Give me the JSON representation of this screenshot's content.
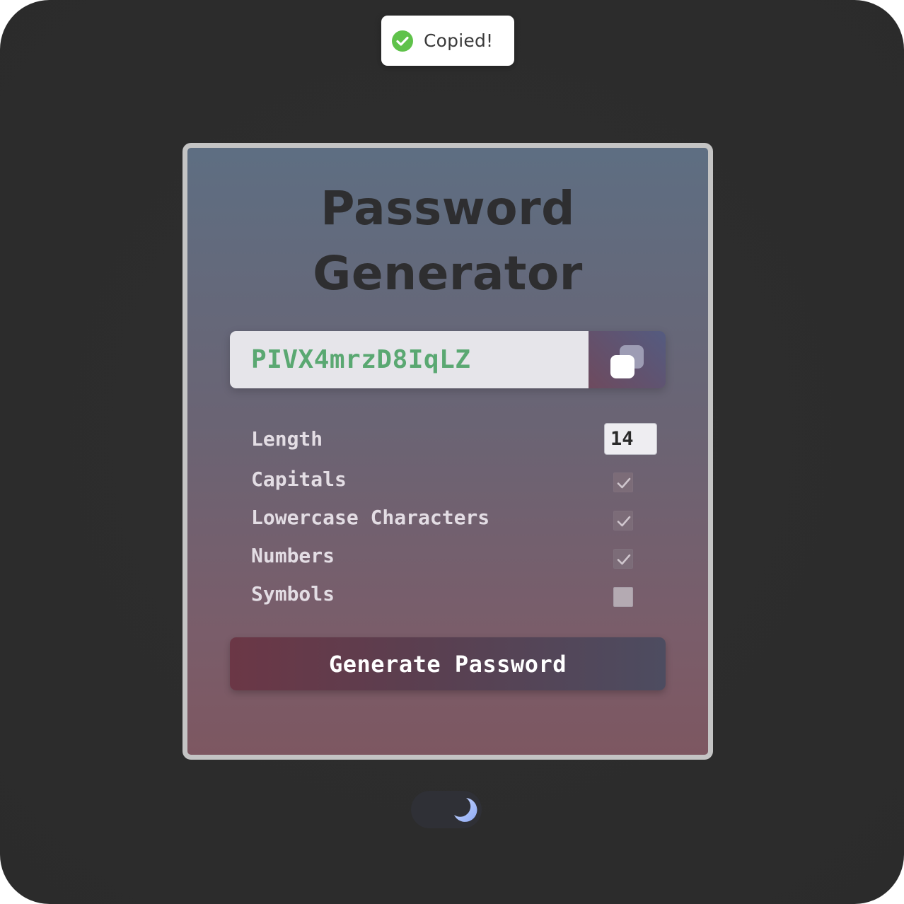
{
  "toast": {
    "message": "Copied!",
    "icon": "check-circle-icon"
  },
  "card": {
    "title_line1": "Password",
    "title_line2": "Generator"
  },
  "password": {
    "value": "PIVX4mrzD8IqLZ",
    "copy_icon": "copy-icon"
  },
  "options": {
    "length_label": "Length",
    "length_value": "14",
    "capitals_label": "Capitals",
    "capitals_checked": true,
    "lowercase_label": "Lowercase Characters",
    "lowercase_checked": true,
    "numbers_label": "Numbers",
    "numbers_checked": true,
    "symbols_label": "Symbols",
    "symbols_checked": false
  },
  "generate_button": {
    "label": "Generate Password"
  },
  "theme_toggle": {
    "icon": "moon-icon",
    "mode": "dark"
  },
  "colors": {
    "password_text": "#5aa872",
    "success": "#5fc24a",
    "moon": "#a9c2ff"
  }
}
